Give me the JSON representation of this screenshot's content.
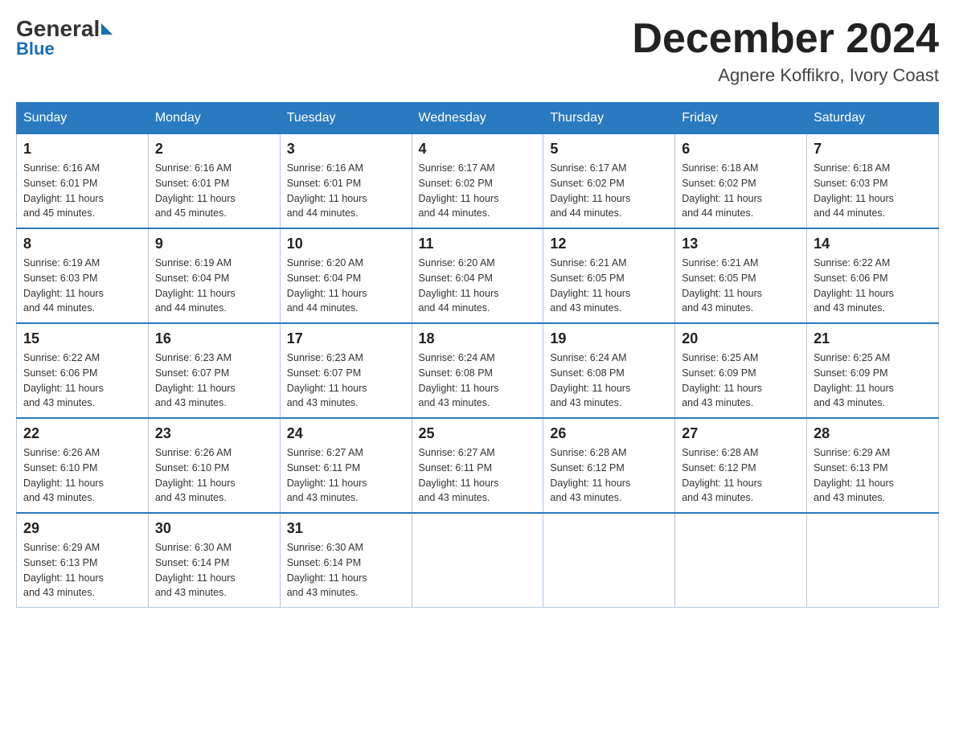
{
  "logo": {
    "general": "General",
    "blue": "Blue"
  },
  "title": {
    "month": "December 2024",
    "location": "Agnere Koffikro, Ivory Coast"
  },
  "weekdays": [
    "Sunday",
    "Monday",
    "Tuesday",
    "Wednesday",
    "Thursday",
    "Friday",
    "Saturday"
  ],
  "weeks": [
    [
      {
        "day": "1",
        "sunrise": "6:16 AM",
        "sunset": "6:01 PM",
        "daylight": "11 hours and 45 minutes."
      },
      {
        "day": "2",
        "sunrise": "6:16 AM",
        "sunset": "6:01 PM",
        "daylight": "11 hours and 45 minutes."
      },
      {
        "day": "3",
        "sunrise": "6:16 AM",
        "sunset": "6:01 PM",
        "daylight": "11 hours and 44 minutes."
      },
      {
        "day": "4",
        "sunrise": "6:17 AM",
        "sunset": "6:02 PM",
        "daylight": "11 hours and 44 minutes."
      },
      {
        "day": "5",
        "sunrise": "6:17 AM",
        "sunset": "6:02 PM",
        "daylight": "11 hours and 44 minutes."
      },
      {
        "day": "6",
        "sunrise": "6:18 AM",
        "sunset": "6:02 PM",
        "daylight": "11 hours and 44 minutes."
      },
      {
        "day": "7",
        "sunrise": "6:18 AM",
        "sunset": "6:03 PM",
        "daylight": "11 hours and 44 minutes."
      }
    ],
    [
      {
        "day": "8",
        "sunrise": "6:19 AM",
        "sunset": "6:03 PM",
        "daylight": "11 hours and 44 minutes."
      },
      {
        "day": "9",
        "sunrise": "6:19 AM",
        "sunset": "6:04 PM",
        "daylight": "11 hours and 44 minutes."
      },
      {
        "day": "10",
        "sunrise": "6:20 AM",
        "sunset": "6:04 PM",
        "daylight": "11 hours and 44 minutes."
      },
      {
        "day": "11",
        "sunrise": "6:20 AM",
        "sunset": "6:04 PM",
        "daylight": "11 hours and 44 minutes."
      },
      {
        "day": "12",
        "sunrise": "6:21 AM",
        "sunset": "6:05 PM",
        "daylight": "11 hours and 43 minutes."
      },
      {
        "day": "13",
        "sunrise": "6:21 AM",
        "sunset": "6:05 PM",
        "daylight": "11 hours and 43 minutes."
      },
      {
        "day": "14",
        "sunrise": "6:22 AM",
        "sunset": "6:06 PM",
        "daylight": "11 hours and 43 minutes."
      }
    ],
    [
      {
        "day": "15",
        "sunrise": "6:22 AM",
        "sunset": "6:06 PM",
        "daylight": "11 hours and 43 minutes."
      },
      {
        "day": "16",
        "sunrise": "6:23 AM",
        "sunset": "6:07 PM",
        "daylight": "11 hours and 43 minutes."
      },
      {
        "day": "17",
        "sunrise": "6:23 AM",
        "sunset": "6:07 PM",
        "daylight": "11 hours and 43 minutes."
      },
      {
        "day": "18",
        "sunrise": "6:24 AM",
        "sunset": "6:08 PM",
        "daylight": "11 hours and 43 minutes."
      },
      {
        "day": "19",
        "sunrise": "6:24 AM",
        "sunset": "6:08 PM",
        "daylight": "11 hours and 43 minutes."
      },
      {
        "day": "20",
        "sunrise": "6:25 AM",
        "sunset": "6:09 PM",
        "daylight": "11 hours and 43 minutes."
      },
      {
        "day": "21",
        "sunrise": "6:25 AM",
        "sunset": "6:09 PM",
        "daylight": "11 hours and 43 minutes."
      }
    ],
    [
      {
        "day": "22",
        "sunrise": "6:26 AM",
        "sunset": "6:10 PM",
        "daylight": "11 hours and 43 minutes."
      },
      {
        "day": "23",
        "sunrise": "6:26 AM",
        "sunset": "6:10 PM",
        "daylight": "11 hours and 43 minutes."
      },
      {
        "day": "24",
        "sunrise": "6:27 AM",
        "sunset": "6:11 PM",
        "daylight": "11 hours and 43 minutes."
      },
      {
        "day": "25",
        "sunrise": "6:27 AM",
        "sunset": "6:11 PM",
        "daylight": "11 hours and 43 minutes."
      },
      {
        "day": "26",
        "sunrise": "6:28 AM",
        "sunset": "6:12 PM",
        "daylight": "11 hours and 43 minutes."
      },
      {
        "day": "27",
        "sunrise": "6:28 AM",
        "sunset": "6:12 PM",
        "daylight": "11 hours and 43 minutes."
      },
      {
        "day": "28",
        "sunrise": "6:29 AM",
        "sunset": "6:13 PM",
        "daylight": "11 hours and 43 minutes."
      }
    ],
    [
      {
        "day": "29",
        "sunrise": "6:29 AM",
        "sunset": "6:13 PM",
        "daylight": "11 hours and 43 minutes."
      },
      {
        "day": "30",
        "sunrise": "6:30 AM",
        "sunset": "6:14 PM",
        "daylight": "11 hours and 43 minutes."
      },
      {
        "day": "31",
        "sunrise": "6:30 AM",
        "sunset": "6:14 PM",
        "daylight": "11 hours and 43 minutes."
      },
      null,
      null,
      null,
      null
    ]
  ],
  "labels": {
    "sunrise": "Sunrise:",
    "sunset": "Sunset:",
    "daylight": "Daylight:"
  }
}
